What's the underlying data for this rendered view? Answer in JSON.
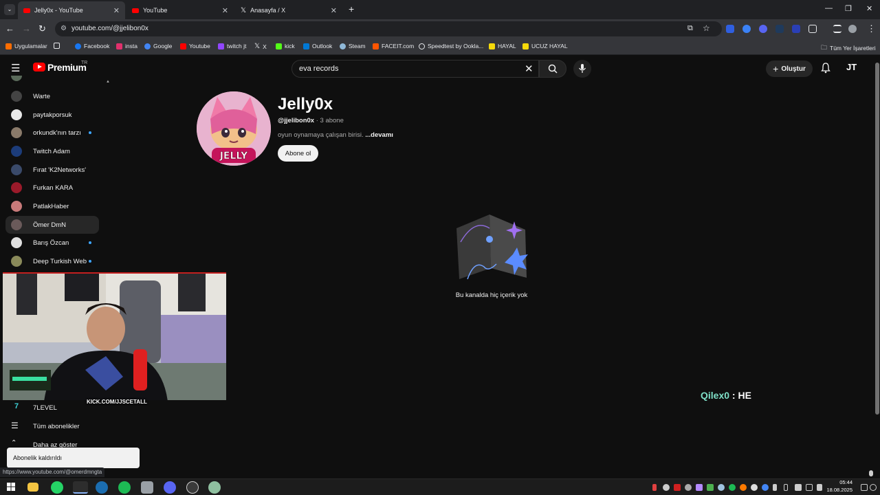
{
  "browser": {
    "tabs": [
      {
        "label": "Jelly0x - YouTube",
        "active": true
      },
      {
        "label": "YouTube",
        "active": false
      },
      {
        "label": "Anasayfa / X",
        "active": false
      }
    ],
    "new_tab": "+",
    "url": "youtube.com/@jjelibon0x",
    "bookmarks": [
      {
        "label": "Uygulamalar",
        "color": "#ff6d00"
      },
      {
        "label": "Facebook",
        "color": "#1877f2"
      },
      {
        "label": "insta",
        "color": "#e1306c"
      },
      {
        "label": "Google",
        "color": "#4285f4"
      },
      {
        "label": "Youtube",
        "color": "#ff0000"
      },
      {
        "label": "twitch jt",
        "color": "#9146ff"
      },
      {
        "label": "X",
        "color": "#000000"
      },
      {
        "label": "kick",
        "color": "#53fc18"
      },
      {
        "label": "Outlook",
        "color": "#0078d4"
      },
      {
        "label": "Steam",
        "color": "#1b2838"
      },
      {
        "label": "FACEIT.com",
        "color": "#ff5500"
      },
      {
        "label": "Speedtest by Ookla...",
        "color": "#141526"
      },
      {
        "label": "HAYAL",
        "color": "#f5d90a"
      },
      {
        "label": "UCUZ HAYAL",
        "color": "#f5d90a"
      }
    ],
    "all_bookmarks": "Tüm Yer İşaretleri",
    "status_url": "https://www.youtube.com/@omerdmngta"
  },
  "youtube": {
    "logo": "Premium",
    "country": "TR",
    "search_value": "eva records",
    "create_label": "Oluştur",
    "avatar_initials": "JT"
  },
  "sidebar": {
    "items": [
      {
        "label": "Warte",
        "dot": false,
        "color": "#444"
      },
      {
        "label": "paytakporsuk",
        "dot": false,
        "color": "#e8e8e8"
      },
      {
        "label": "orkundk'nın tarzı",
        "dot": true,
        "color": "#8a7a6a"
      },
      {
        "label": "Twitch Adam",
        "dot": false,
        "color": "#1c3c7a"
      },
      {
        "label": "Fırat 'K2Networks'",
        "dot": false,
        "color": "#3a4a6a"
      },
      {
        "label": "Furkan KARA",
        "dot": false,
        "color": "#9a1a2a"
      },
      {
        "label": "PatlakHaber",
        "dot": false,
        "color": "#c87a7a"
      },
      {
        "label": "Ömer DmN",
        "dot": false,
        "color": "#6a5a5a"
      },
      {
        "label": "Barış Özcan",
        "dot": true,
        "color": "#e0e0e0"
      },
      {
        "label": "Deep Turkish Web",
        "dot": true,
        "color": "#8a8a5a"
      }
    ],
    "bottom_items": [
      {
        "label": "7LEVEL"
      },
      {
        "label": "Tüm abonelikler"
      },
      {
        "label": "Daha az göster"
      }
    ]
  },
  "channel": {
    "name": "Jelly0x",
    "handle": "@jjelibon0x",
    "subscribers": "· 3 abone",
    "description": "oyun oynamaya çalışan birisi.",
    "more": "...devamı",
    "subscribe_label": "Abone ol",
    "empty_message": "Bu kanalda hiç içerik yok"
  },
  "overlay": {
    "cam_label": "KICK.COM/JJSCETALL",
    "chat_user": "Qilex0",
    "chat_sep": " : ",
    "chat_msg": "HE",
    "chat_user_color": "#7fe0c8"
  },
  "toast": "Abonelik kaldırıldı",
  "taskbar": {
    "time": "05:44",
    "date": "18.08.2025"
  }
}
